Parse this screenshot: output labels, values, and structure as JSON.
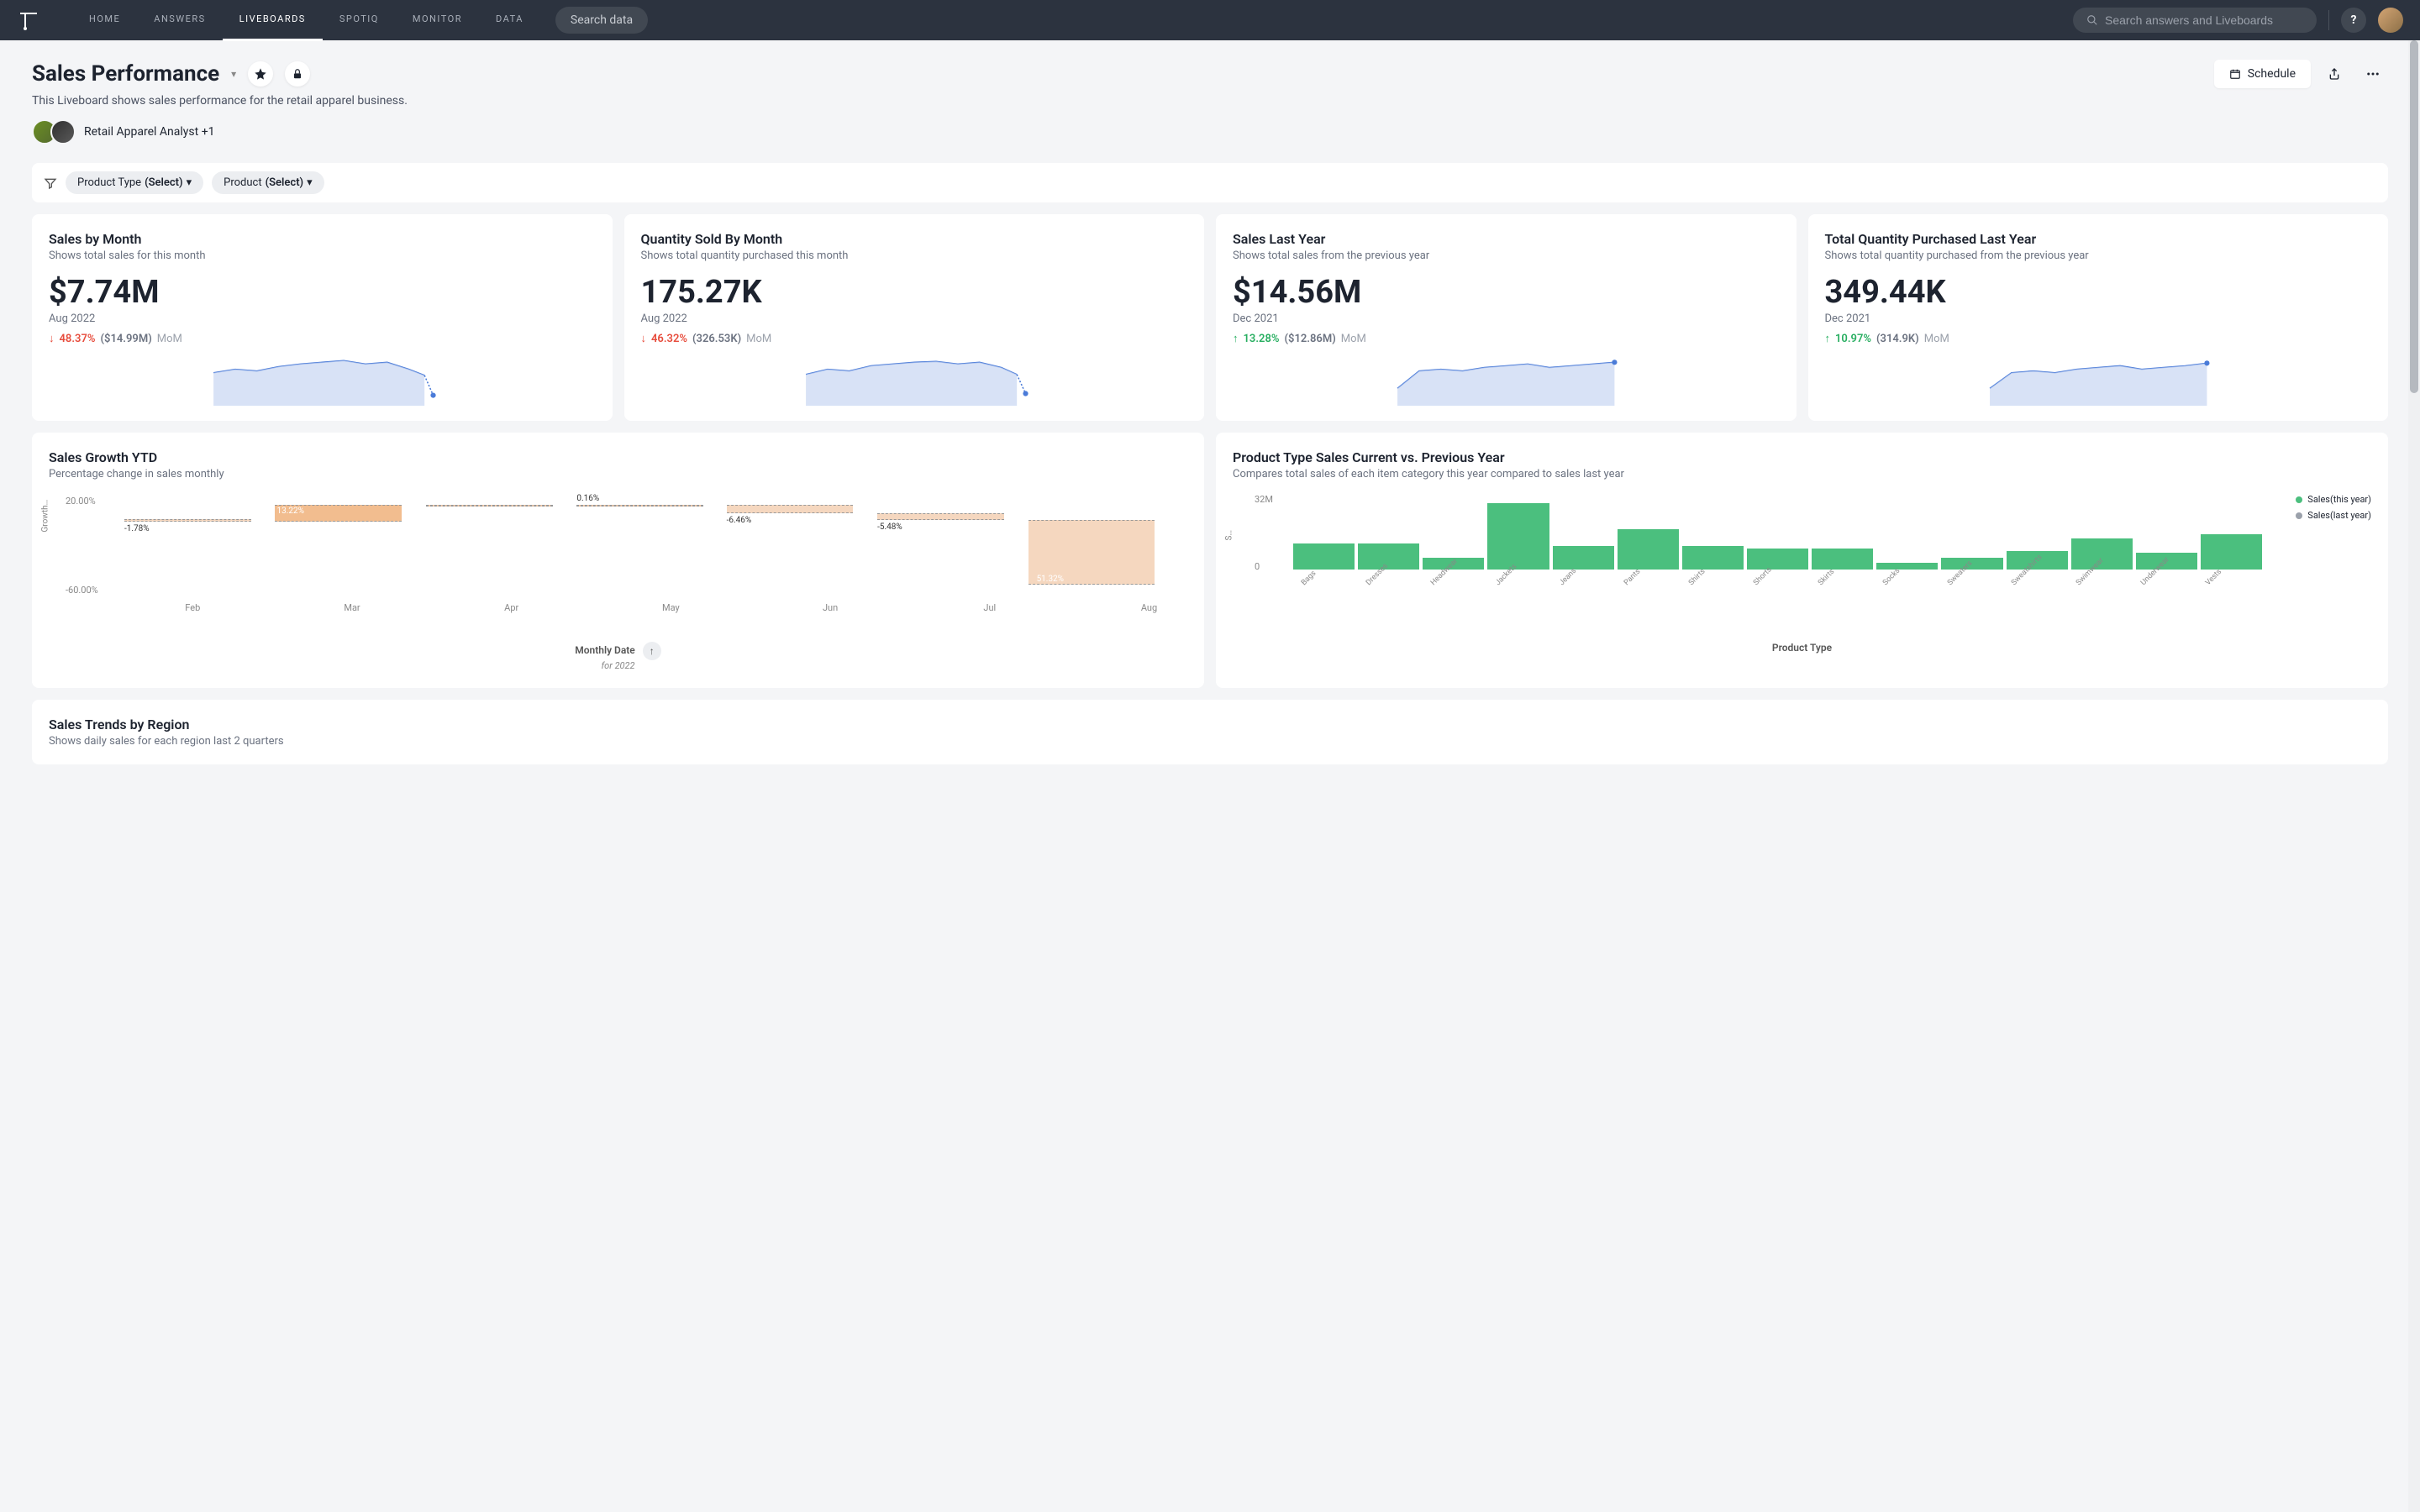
{
  "nav": {
    "items": [
      "HOME",
      "ANSWERS",
      "LIVEBOARDS",
      "SPOTIQ",
      "MONITOR",
      "DATA"
    ],
    "active_index": 2,
    "search_pill": "Search data",
    "search_placeholder": "Search answers and Liveboards"
  },
  "header": {
    "title": "Sales Performance",
    "subtitle": "This Liveboard shows sales performance for the retail apparel business.",
    "analyst_label": "Retail Apparel Analyst +1",
    "schedule_label": "Schedule"
  },
  "filters": {
    "chips": [
      {
        "label": "Product Type",
        "value": "(Select)"
      },
      {
        "label": "Product",
        "value": "(Select)"
      }
    ]
  },
  "kpis": [
    {
      "title": "Sales by Month",
      "sub": "Shows total sales for this month",
      "value": "$7.74M",
      "date": "Aug 2022",
      "direction": "down",
      "pct": "48.37%",
      "ref": "($14.99M)",
      "mom": "MoM"
    },
    {
      "title": "Quantity Sold By Month",
      "sub": "Shows total quantity purchased this month",
      "value": "175.27K",
      "date": "Aug 2022",
      "direction": "down",
      "pct": "46.32%",
      "ref": "(326.53K)",
      "mom": "MoM"
    },
    {
      "title": "Sales Last Year",
      "sub": "Shows total sales from the previous year",
      "value": "$14.56M",
      "date": "Dec 2021",
      "direction": "up",
      "pct": "13.28%",
      "ref": "($12.86M)",
      "mom": "MoM"
    },
    {
      "title": "Total Quantity Purchased Last Year",
      "sub": "Shows total quantity purchased from the previous year",
      "value": "349.44K",
      "date": "Dec 2021",
      "direction": "up",
      "pct": "10.97%",
      "ref": "(314.9K)",
      "mom": "MoM"
    }
  ],
  "growth_card": {
    "title": "Sales Growth YTD",
    "sub": "Percentage change in sales monthly",
    "yaxis": "Growth…",
    "y_top": "20.00%",
    "y_bottom": "-60.00%",
    "axis_title": "Monthly Date",
    "axis_sub": "for 2022"
  },
  "product_card": {
    "title": "Product Type Sales Current vs. Previous Year",
    "sub": "Compares total sales of each item category this year compared to sales last year",
    "yaxis": "S…",
    "y_top": "32M",
    "y_bottom": "0",
    "legend": [
      "Sales(this year)",
      "Sales(last year)"
    ],
    "axis_title": "Product Type"
  },
  "bottom_card": {
    "title": "Sales Trends by Region",
    "sub": "Shows daily sales for each region last 2 quarters"
  },
  "chart_data": [
    {
      "type": "bar",
      "name": "Sales Growth YTD",
      "categories": [
        "Feb",
        "Mar",
        "Apr",
        "May",
        "Jun",
        "Jul",
        "Aug"
      ],
      "values": [
        -1.78,
        13.22,
        0.16,
        0.16,
        -6.46,
        -5.48,
        -51.32
      ],
      "labels": [
        "-1.78%",
        "13.22%",
        "",
        "0.16%",
        "-6.46%",
        "-5.48%",
        "51.32%"
      ],
      "ylabel": "Growth",
      "ylim": [
        -60,
        20
      ],
      "xlabel": "Monthly Date for 2022"
    },
    {
      "type": "bar",
      "name": "Product Type Sales Current vs. Previous Year",
      "categories": [
        "Bags",
        "Dresses",
        "Headwear",
        "Jackets",
        "Jeans",
        "Pants",
        "Shirts",
        "Shorts",
        "Skirts",
        "Socks",
        "Sweaters",
        "Sweatshirts",
        "Swimwear",
        "Underwear",
        "Vests"
      ],
      "series": [
        {
          "name": "Sales(this year)",
          "values": [
            11,
            11,
            5,
            28,
            10,
            17,
            10,
            9,
            9,
            3,
            5,
            8,
            13,
            7,
            15
          ]
        },
        {
          "name": "Sales(last year)",
          "values": null
        }
      ],
      "ylabel": "Sales",
      "ylim": [
        0,
        32
      ],
      "xlabel": "Product Type"
    }
  ],
  "colors": {
    "accent_blue": "#4a7bd8",
    "spark_fill": "#c7d6f2",
    "down": "#e74c3c",
    "up": "#27ae60",
    "bar_green": "#4bbf7e",
    "bar_peach": "#f2c9a8"
  }
}
